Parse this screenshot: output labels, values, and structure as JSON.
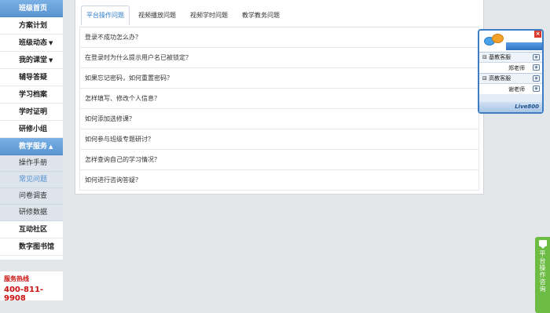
{
  "sidebar": {
    "top_item": "班级首页",
    "items": [
      {
        "label": "方案计划",
        "arrow": ""
      },
      {
        "label": "班级动态",
        "arrow": "▼"
      },
      {
        "label": "我的课堂",
        "arrow": "▼"
      },
      {
        "label": "辅导答疑",
        "arrow": ""
      },
      {
        "label": "学习档案",
        "arrow": ""
      },
      {
        "label": "学时证明",
        "arrow": ""
      },
      {
        "label": "研修小组",
        "arrow": ""
      }
    ],
    "section": {
      "label": "教学服务",
      "arrow": "▲"
    },
    "sub_items": [
      "操作手册",
      "常见问题",
      "问卷调查",
      "研修数据"
    ],
    "active_sub": "常见问题",
    "bottom_items": [
      "互动社区",
      "数字图书馆"
    ]
  },
  "hotline": {
    "label": "服务热线",
    "number": "400-811-9908"
  },
  "tabs": [
    "平台操作问题",
    "视频播放问题",
    "视频学时问题",
    "教学教务问题"
  ],
  "active_tab": "平台操作问题",
  "questions": [
    "登录不成功怎么办？",
    "在登录时为什么提示用户名已被锁定？",
    "如果忘记密码，如何重置密码？",
    "怎样填写、修改个人信息？",
    "如何添加选修课？",
    "如何参与班级专题研讨？",
    "怎样查询自己的学习情况？",
    "如何进行咨询答疑？"
  ],
  "live800": {
    "close": "×",
    "groups": [
      {
        "name": "基教客服",
        "agent": "郑老师"
      },
      {
        "name": "高教客服",
        "agent": "谢老师"
      }
    ],
    "brand": "Live800"
  },
  "consult_tab": {
    "label": "平台操作咨询"
  },
  "colors": {
    "sidebar_blue": "#5a95d2",
    "hotline_red": "#cc1010",
    "tab_active": "#2f7ec9",
    "consult_green": "#6dbd45"
  }
}
